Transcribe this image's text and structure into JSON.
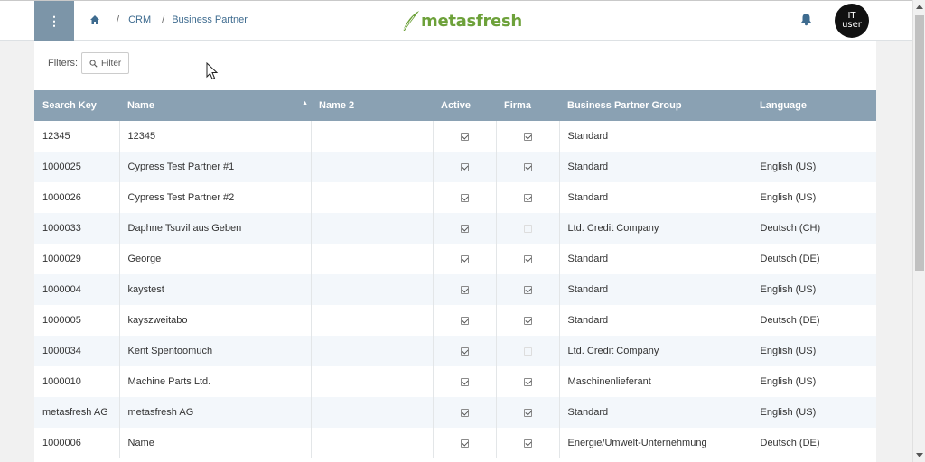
{
  "header": {
    "menu_glyph": "⋮",
    "breadcrumb": {
      "home_icon": "home-icon",
      "sep": "/",
      "items": [
        "CRM",
        "Business Partner"
      ]
    },
    "logo_text": "metasfresh",
    "bell_icon": "bell-icon",
    "avatar": {
      "line1": "IT",
      "line2": "user"
    }
  },
  "filters": {
    "label": "Filters:",
    "button_label": "Filter"
  },
  "table": {
    "columns": [
      "Search Key",
      "Name",
      "Name 2",
      "Active",
      "Firma",
      "Business Partner Group",
      "Language"
    ],
    "rows": [
      {
        "key": "12345",
        "name": "12345",
        "name2": "",
        "active": true,
        "firma": true,
        "group": "Standard",
        "lang": ""
      },
      {
        "key": "1000025",
        "name": "Cypress Test Partner #1",
        "name2": "",
        "active": true,
        "firma": true,
        "group": "Standard",
        "lang": "English (US)"
      },
      {
        "key": "1000026",
        "name": "Cypress Test Partner #2",
        "name2": "",
        "active": true,
        "firma": true,
        "group": "Standard",
        "lang": "English (US)"
      },
      {
        "key": "1000033",
        "name": "Daphne Tsuvil aus Geben",
        "name2": "",
        "active": true,
        "firma": false,
        "group": "Ltd. Credit Company",
        "lang": "Deutsch (CH)"
      },
      {
        "key": "1000029",
        "name": "George",
        "name2": "",
        "active": true,
        "firma": true,
        "group": "Standard",
        "lang": "Deutsch (DE)"
      },
      {
        "key": "1000004",
        "name": "kaystest",
        "name2": "",
        "active": true,
        "firma": true,
        "group": "Standard",
        "lang": "English (US)"
      },
      {
        "key": "1000005",
        "name": "kayszweitabo",
        "name2": "",
        "active": true,
        "firma": true,
        "group": "Standard",
        "lang": "Deutsch (DE)"
      },
      {
        "key": "1000034",
        "name": "Kent Spentoomuch",
        "name2": "",
        "active": true,
        "firma": false,
        "group": "Ltd. Credit Company",
        "lang": "English (US)"
      },
      {
        "key": "1000010",
        "name": "Machine Parts Ltd.",
        "name2": "",
        "active": true,
        "firma": true,
        "group": "Maschinenlieferant",
        "lang": "English (US)"
      },
      {
        "key": "metasfresh AG",
        "name": "metasfresh AG",
        "name2": "",
        "active": true,
        "firma": true,
        "group": "Standard",
        "lang": "English (US)"
      },
      {
        "key": "1000006",
        "name": "Name",
        "name2": "",
        "active": true,
        "firma": true,
        "group": "Energie/Umwelt-Unternehmung",
        "lang": "Deutsch (DE)"
      }
    ]
  },
  "colors": {
    "header_bar": "#8aa1b3",
    "menu_button": "#7c95a8",
    "brand": "#6da13a",
    "link": "#3e6b8f"
  }
}
